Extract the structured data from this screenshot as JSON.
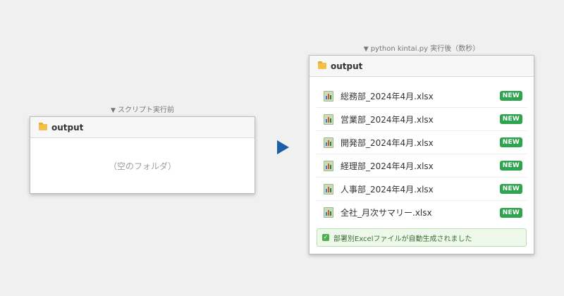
{
  "before": {
    "caption": "スクリプト実行前",
    "window_title": "output",
    "empty_text": "（空のフォルダ）"
  },
  "after": {
    "caption": "python kintai.py 実行後（数秒）",
    "window_title": "output",
    "files": [
      {
        "name": "総務部_2024年4月.xlsx",
        "badge": "NEW"
      },
      {
        "name": "営業部_2024年4月.xlsx",
        "badge": "NEW"
      },
      {
        "name": "開発部_2024年4月.xlsx",
        "badge": "NEW"
      },
      {
        "name": "経理部_2024年4月.xlsx",
        "badge": "NEW"
      },
      {
        "name": "人事部_2024年4月.xlsx",
        "badge": "NEW"
      },
      {
        "name": "全社_月次サマリー.xlsx",
        "badge": "NEW"
      }
    ],
    "status": "部署別Excelファイルが自動生成されました"
  },
  "icons": {
    "caption_marker": "triangle-down-icon",
    "folder": "folder-icon",
    "file": "xlsx-file-icon",
    "arrow": "arrow-right-icon",
    "status": "check-icon"
  },
  "colors": {
    "arrow": "#1b5fa8",
    "badge": "#2ea44f",
    "folder": "#f5c04a",
    "status_bg": "#eef8ea"
  }
}
